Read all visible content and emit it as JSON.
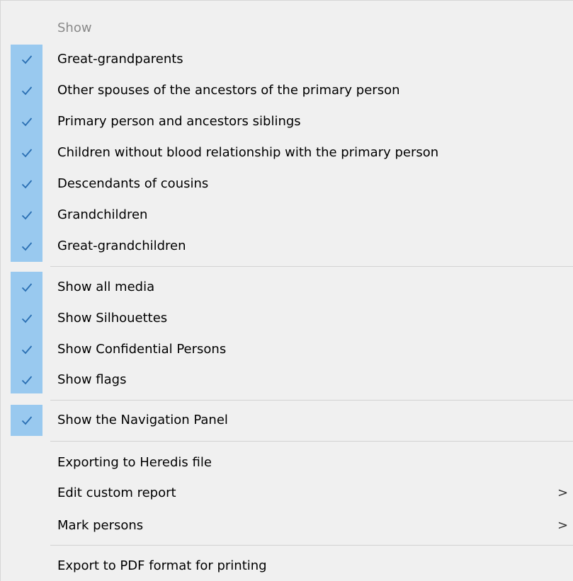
{
  "menu": {
    "header": "Show",
    "groups": {
      "relatives": [
        "Great-grandparents",
        "Other spouses of the ancestors of the primary person",
        "Primary person and ancestors siblings",
        "Children without blood relationship with the primary person",
        "Descendants of cousins",
        "Grandchildren",
        "Great-grandchildren"
      ],
      "display": [
        "Show all media",
        "Show Silhouettes",
        "Show Confidential Persons",
        "Show flags"
      ],
      "panel": [
        "Show the Navigation Panel"
      ]
    },
    "actions": {
      "export_heredis": "Exporting to Heredis file",
      "edit_custom_report": "Edit custom report",
      "mark_persons": "Mark persons",
      "export_pdf": "Export to PDF format for printing"
    },
    "submenu_arrow": ">",
    "check_glyph": "✓",
    "colors": {
      "check_highlight": "#99c9ef",
      "check_mark": "#2a6fb3",
      "background": "#f0f0f0",
      "disabled_text": "#8a8a8a"
    }
  }
}
